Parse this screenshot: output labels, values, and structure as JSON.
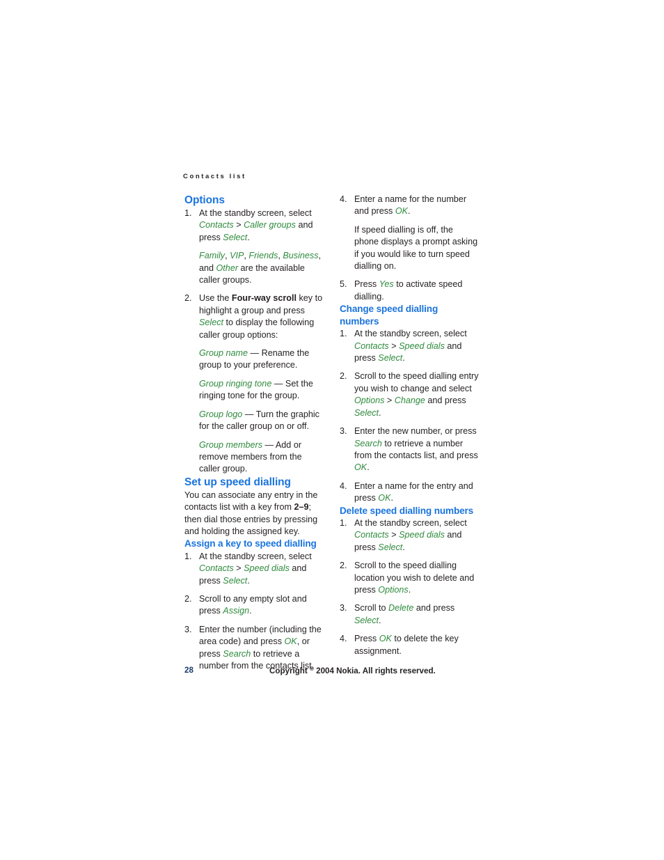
{
  "document": {
    "running_header": "Contacts list",
    "page_number": "28",
    "copyright_prefix": "Copyright",
    "copyright_symbol": "®",
    "copyright_suffix": "2004 Nokia. All rights reserved."
  },
  "left_column": {
    "options_heading": "Options",
    "step1": {
      "part1": "At the standby screen, select ",
      "ui1": "Contacts",
      "sep1": " > ",
      "ui2": "Caller groups",
      "part2": " and press ",
      "ui3": "Select",
      "part3": ".",
      "sub": {
        "ui_family": "Family",
        "c1": ", ",
        "ui_vip": "VIP",
        "c2": ", ",
        "ui_friends": "Friends",
        "c3": ", ",
        "ui_business": "Business",
        "c4": ", and ",
        "ui_other": "Other",
        "tail": " are the available caller groups."
      }
    },
    "step2": {
      "part1": "Use the ",
      "strong1": "Four-way scroll",
      "part2": " key to highlight a group and press ",
      "ui1": "Select",
      "part3": " to display the following caller group options:",
      "defs": [
        {
          "term": "Group name",
          "dash": " — ",
          "desc": "Rename the group to your preference."
        },
        {
          "term": "Group ringing tone",
          "dash": " — ",
          "desc": "Set the ringing tone for the group."
        },
        {
          "term": "Group logo",
          "dash": " — ",
          "desc": "Turn the graphic for the caller group on or off."
        },
        {
          "term": "Group members",
          "dash": " — ",
          "desc": "Add or remove members from the caller group."
        }
      ]
    },
    "setup_heading": "Set up speed dialling",
    "setup_intro": {
      "part1": "You can associate any entry in the contacts list with a key from ",
      "strong1": "2–9",
      "part2": "; then dial those entries by pressing and holding the assigned key."
    },
    "assign_heading": "Assign a key to speed dialling",
    "assign_step1": {
      "part1": "At the standby screen, select ",
      "ui1": "Contacts",
      "sep1": " > ",
      "ui2": "Speed dials",
      "part2": " and press ",
      "ui3": "Select",
      "part3": "."
    },
    "assign_step2": {
      "part1": "Scroll to any empty slot and press ",
      "ui1": "Assign",
      "part2": "."
    },
    "assign_step3": {
      "part1": "Enter the number (including the area code) and press ",
      "ui1": "OK",
      "part2": ", or press ",
      "ui2": "Search",
      "part3": " to retrieve a number from the contacts list."
    }
  },
  "right_column": {
    "assign_step4": {
      "part1": "Enter a name for the number and press ",
      "ui1": "OK",
      "part2": ".",
      "sub": "If speed dialling is off, the phone displays a prompt asking if you would like to turn speed dialling on."
    },
    "assign_step5": {
      "part1": "Press ",
      "ui1": "Yes",
      "part2": " to activate speed dialling."
    },
    "change_heading": "Change speed dialling numbers",
    "change_step1": {
      "part1": "At the standby screen, select ",
      "ui1": "Contacts",
      "sep1": " > ",
      "ui2": "Speed dials",
      "part2": " and press ",
      "ui3": "Select",
      "part3": "."
    },
    "change_step2": {
      "part1": "Scroll to the speed dialling entry you wish to change and select ",
      "ui1": "Options",
      "sep1": " > ",
      "ui2": "Change",
      "part2": " and press ",
      "ui3": "Select",
      "part3": "."
    },
    "change_step3": {
      "part1": "Enter the new number, or press ",
      "ui1": "Search",
      "part2": " to retrieve a number from the contacts list, and press ",
      "ui2": "OK",
      "part3": "."
    },
    "change_step4": {
      "part1": "Enter a name for the entry and press ",
      "ui1": "OK",
      "part2": "."
    },
    "delete_heading": "Delete speed dialling numbers",
    "delete_step1": {
      "part1": "At the standby screen, select ",
      "ui1": "Contacts",
      "sep1": " > ",
      "ui2": "Speed dials",
      "part2": " and press ",
      "ui3": "Select",
      "part3": "."
    },
    "delete_step2": {
      "part1": "Scroll to the speed dialling location you wish to delete and press ",
      "ui1": "Options",
      "part2": "."
    },
    "delete_step3": {
      "part1": "Scroll to ",
      "ui1": "Delete",
      "part2": " and press ",
      "ui2": "Select",
      "part3": "."
    },
    "delete_step4": {
      "part1": "Press ",
      "ui1": "OK",
      "part2": " to delete the key assignment."
    }
  },
  "colors": {
    "heading_blue": "#1a74dd",
    "ui_green": "#2f8b3e",
    "body_black": "#231f20",
    "pageno_navy": "#1b3a6b"
  }
}
